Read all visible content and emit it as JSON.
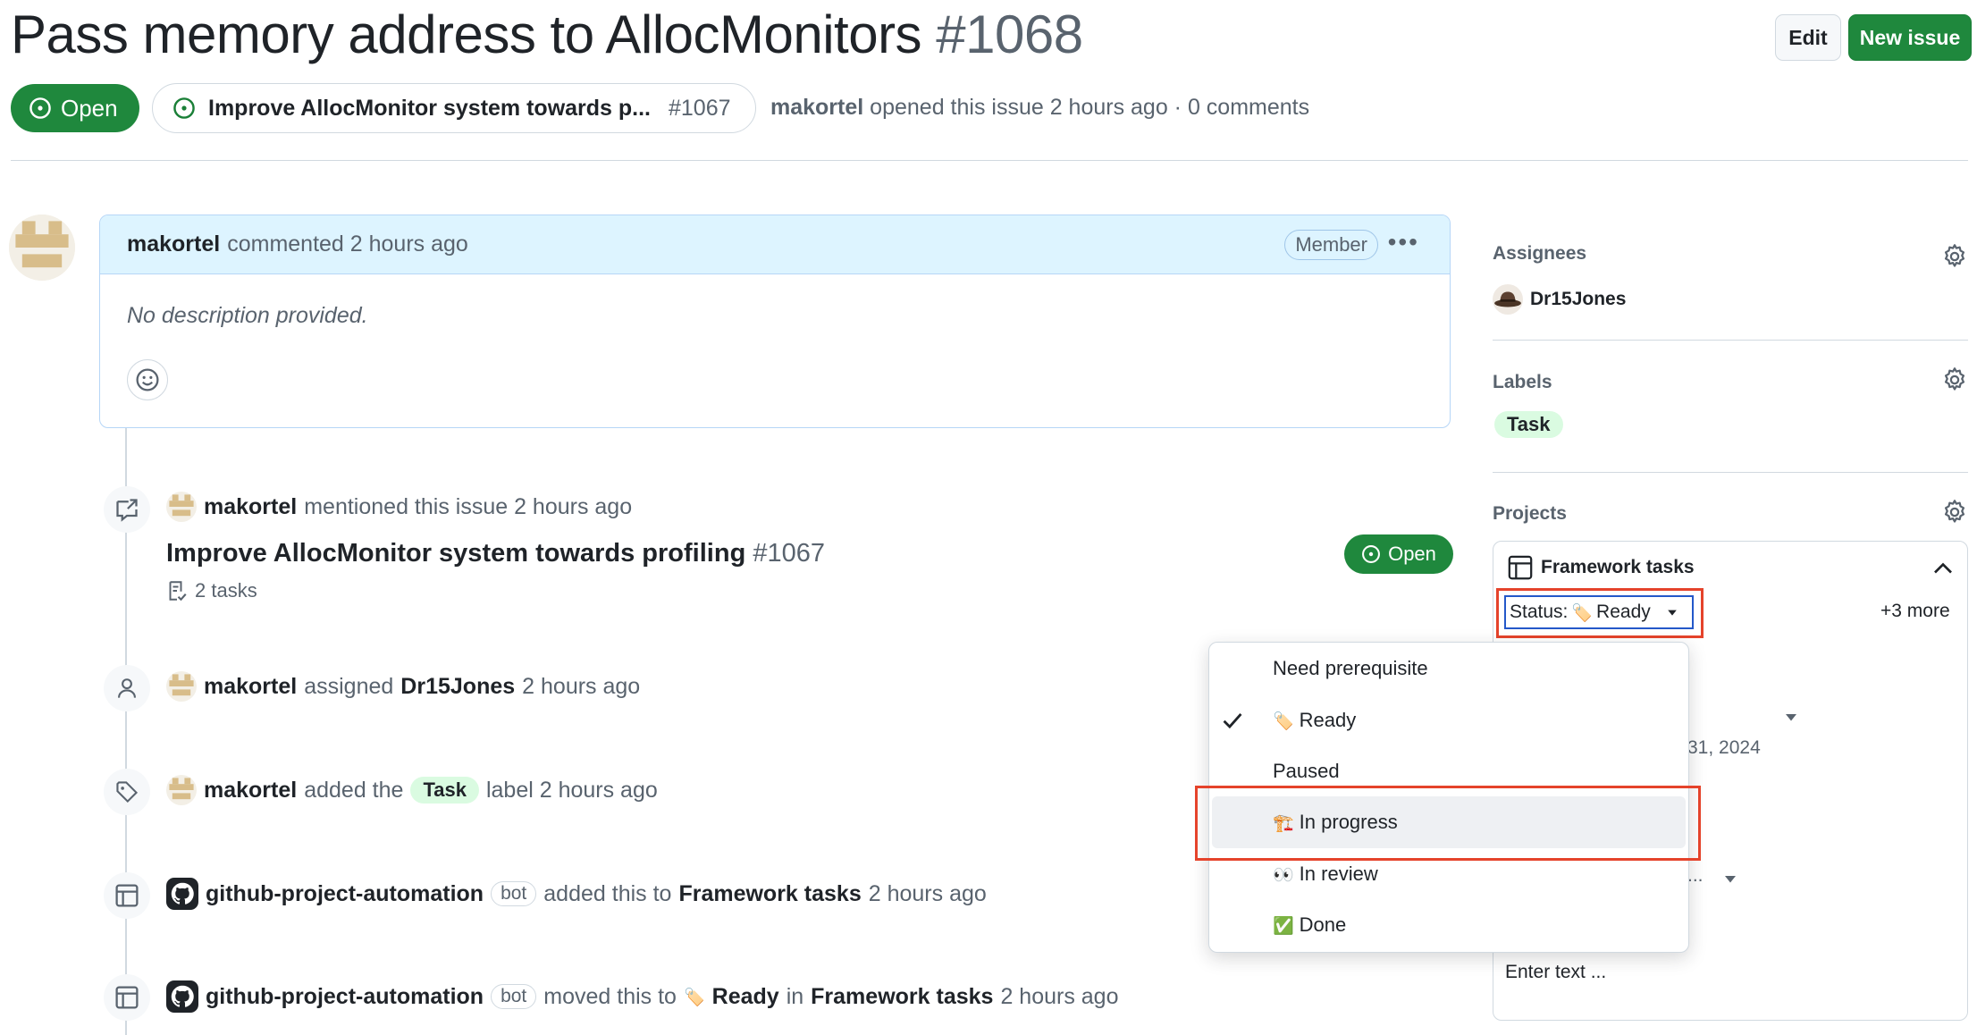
{
  "header": {
    "title": "Pass memory address to AllocMonitors",
    "number": "#1068",
    "edit_label": "Edit",
    "new_issue_label": "New issue",
    "state": "Open",
    "parent": {
      "title": "Improve AllocMonitor system towards p...",
      "number": "#1067"
    },
    "author": "makortel",
    "meta_text": "opened this issue 2 hours ago · 0 comments"
  },
  "comment": {
    "author": "makortel",
    "time": "commented 2 hours ago",
    "role": "Member",
    "body": "No description provided."
  },
  "timeline": {
    "mention": {
      "actor": "makortel",
      "text": "mentioned this issue 2 hours ago",
      "ref_title": "Improve AllocMonitor system towards profiling",
      "ref_number": "#1067",
      "ref_tasks": "2 tasks",
      "ref_state": "Open"
    },
    "assign": {
      "actor": "makortel",
      "verb": "assigned",
      "target": "Dr15Jones",
      "time": "2 hours ago"
    },
    "label": {
      "actor": "makortel",
      "verb": "added the",
      "label": "Task",
      "suffix": "label 2 hours ago"
    },
    "project_add": {
      "actor": "github-project-automation",
      "bot": "bot",
      "verb": "added this to",
      "project": "Framework tasks",
      "time": "2 hours ago"
    },
    "project_move": {
      "actor": "github-project-automation",
      "bot": "bot",
      "verb": "moved this to",
      "status_emoji": "🏷️",
      "status": "Ready",
      "in": "in",
      "project": "Framework tasks",
      "time": "2 hours ago"
    }
  },
  "sidebar": {
    "assignees_heading": "Assignees",
    "assignee": "Dr15Jones",
    "labels_heading": "Labels",
    "label": "Task",
    "projects_heading": "Projects",
    "project_name": "Framework tasks",
    "status_prefix": "Status:",
    "status_emoji": "🏷️",
    "status_value": "Ready",
    "more": "+3 more",
    "date_partial": "31, 2024",
    "ellipsis": "...",
    "text_placeholder": "Enter text ..."
  },
  "status_menu": {
    "options": [
      {
        "emoji": "",
        "label": "Need prerequisite",
        "selected": false
      },
      {
        "emoji": "🏷️",
        "label": "Ready",
        "selected": true
      },
      {
        "emoji": "",
        "label": "Paused",
        "selected": false
      },
      {
        "emoji": "🏗️",
        "label": "In progress",
        "selected": false,
        "highlighted": true
      },
      {
        "emoji": "👀",
        "label": "In review",
        "selected": false
      },
      {
        "emoji": "✅",
        "label": "Done",
        "selected": false
      }
    ]
  },
  "colors": {
    "green": "#1f883d",
    "blue_header": "#ddf4ff",
    "highlight_red": "#e5432b",
    "focus_blue": "#2458c9",
    "muted": "#59636e"
  },
  "icons": [
    "issue-open-icon",
    "gear-icon",
    "smiley-icon",
    "cross-reference-icon",
    "person-icon",
    "tag-icon",
    "table-icon",
    "checklist-icon",
    "chevron-up-icon",
    "caret-down-icon",
    "check-icon",
    "github-mark-icon"
  ]
}
